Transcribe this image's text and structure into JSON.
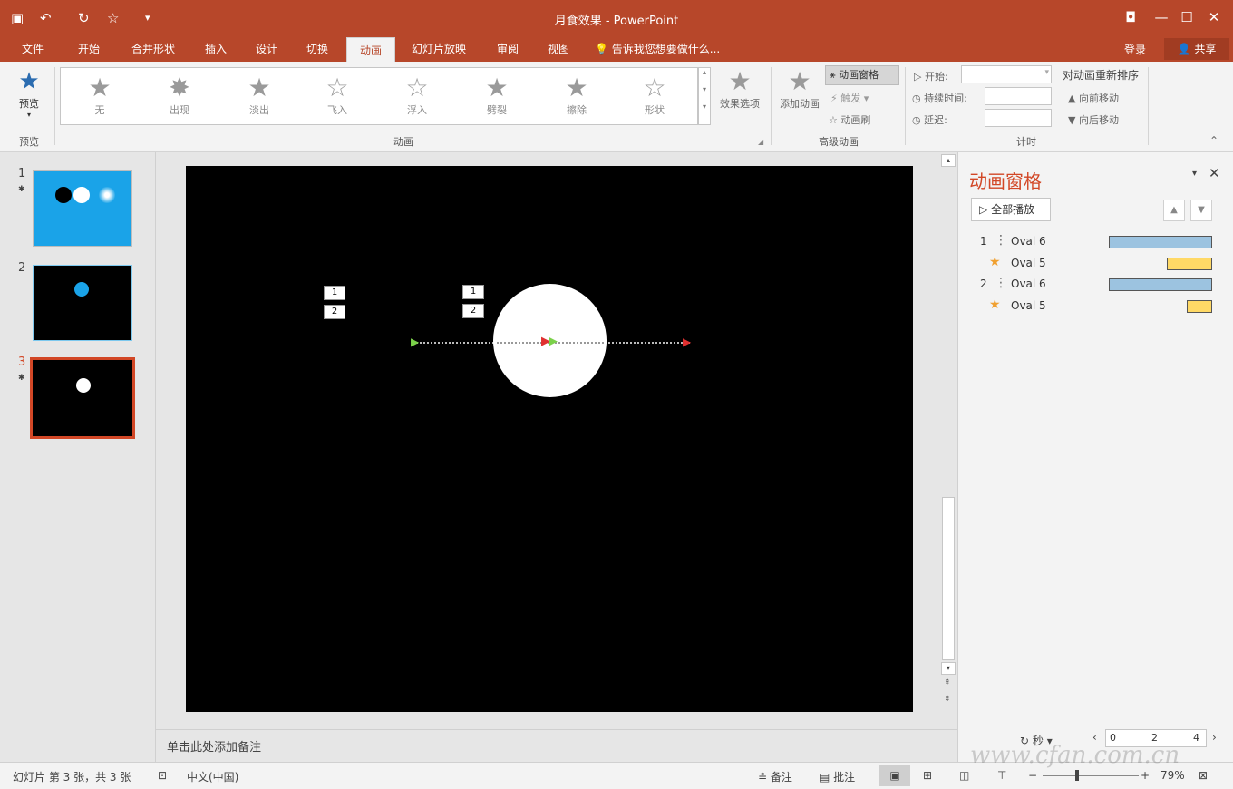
{
  "titlebar": {
    "title": "月食效果 - PowerPoint",
    "qa": {
      "save_icon": "▣",
      "undo_icon": "↶",
      "redo_icon": "↻",
      "tools_icon": "☆",
      "more_icon": "▾"
    },
    "window": {
      "ribbon_display": "◘",
      "minimize": "—",
      "maximize": "☐",
      "close": "✕"
    }
  },
  "tabs": [
    {
      "label": "文件"
    },
    {
      "label": "开始"
    },
    {
      "label": "合并形状"
    },
    {
      "label": "插入"
    },
    {
      "label": "设计"
    },
    {
      "label": "切换"
    },
    {
      "label": "动画"
    },
    {
      "label": "幻灯片放映"
    },
    {
      "label": "审阅"
    },
    {
      "label": "视图"
    }
  ],
  "tellme": "告诉我您想要做什么...",
  "signin": "登录",
  "share": "共享",
  "ribbon": {
    "preview_label": "预览",
    "preview_group": "预览",
    "gallery": [
      {
        "label": "无"
      },
      {
        "label": "出现"
      },
      {
        "label": "淡出"
      },
      {
        "label": "飞入"
      },
      {
        "label": "浮入"
      },
      {
        "label": "劈裂"
      },
      {
        "label": "擦除"
      },
      {
        "label": "形状"
      }
    ],
    "animation_group": "动画",
    "effect_options": "效果选项",
    "add_animation": "添加动画",
    "animation_pane": "动画窗格",
    "trigger": "触发",
    "painter": "动画刷",
    "advanced_group": "高级动画",
    "start": "开始:",
    "duration": "持续时间:",
    "delay": "延迟:",
    "timing_group": "计时",
    "reorder": "对动画重新排序",
    "move_earlier": "向前移动",
    "move_later": "向后移动",
    "collapse_icon": "⌃"
  },
  "thumbnails": [
    {
      "num": "1",
      "star": "✱"
    },
    {
      "num": "2",
      "star": ""
    },
    {
      "num": "3",
      "star": "✱"
    }
  ],
  "slide": {
    "tags": [
      "1",
      "2",
      "1",
      "2"
    ]
  },
  "notes": "单击此处添加备注",
  "anim_pane": {
    "title": "动画窗格",
    "play_all": "全部播放",
    "items": [
      {
        "num": "1",
        "name": "Oval 6"
      },
      {
        "num": "",
        "name": "Oval 5"
      },
      {
        "num": "2",
        "name": "Oval 6"
      },
      {
        "num": "",
        "name": "Oval 5"
      }
    ],
    "seconds_label": "秒",
    "timeline": [
      "0",
      "2",
      "4"
    ]
  },
  "status": {
    "slide_info": "幻灯片 第 3 张，共 3 张",
    "language": "中文(中国)",
    "notes_btn": "备注",
    "comments_btn": "批注",
    "zoom": "79%"
  },
  "watermark": "www.cfan.com.cn"
}
